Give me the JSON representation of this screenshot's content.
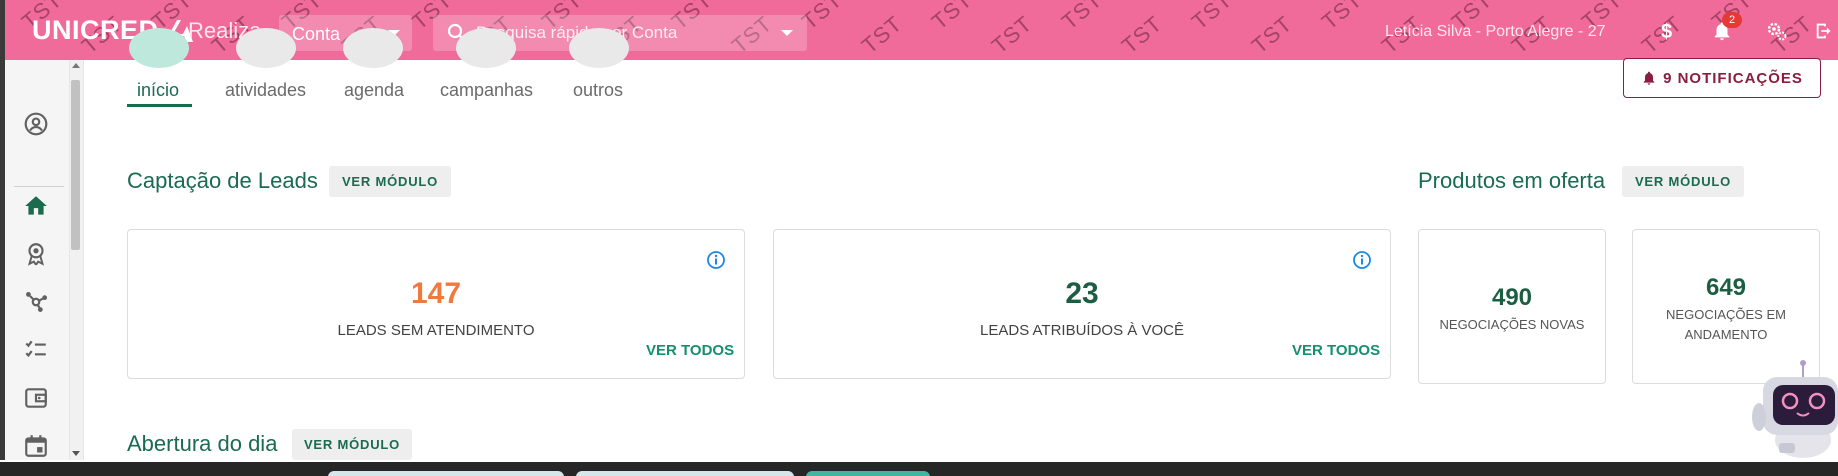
{
  "header": {
    "logo_text": "UNICRED",
    "app_name": "Realiza",
    "context_select_value": "Conta",
    "search_placeholder": "Pesquisa rápida por Conta",
    "user_info": "Letícia Silva   -   Porto Alegre - 27",
    "notifications_badge": "2",
    "watermark_text": "TST",
    "icons": [
      "dollar-icon",
      "bell-icon",
      "settings-icon",
      "logout-icon"
    ],
    "bar_color": "#f06a9a"
  },
  "sidebar": {
    "items": [
      {
        "name": "account-icon",
        "active": false
      },
      {
        "name": "home-icon",
        "active": true
      },
      {
        "name": "award-icon",
        "active": false
      },
      {
        "name": "hub-icon",
        "active": false
      },
      {
        "name": "checklist-icon",
        "active": false
      },
      {
        "name": "wallet-icon",
        "active": false
      },
      {
        "name": "calendar-icon",
        "active": false
      }
    ]
  },
  "tabs": [
    {
      "label": "início",
      "active": true
    },
    {
      "label": "atividades",
      "active": false
    },
    {
      "label": "agenda",
      "active": false
    },
    {
      "label": "campanhas",
      "active": false
    },
    {
      "label": "outros",
      "active": false
    }
  ],
  "notifications_button": "9 NOTIFICAÇÕES",
  "sections": {
    "leads": {
      "title": "Captação de Leads",
      "module_button": "VER MÓDULO",
      "cards": [
        {
          "value": "147",
          "label": "LEADS SEM ATENDIMENTO",
          "link": "VER TODOS",
          "value_color": "#f07a3e"
        },
        {
          "value": "23",
          "label": "LEADS ATRIBUÍDOS À VOCÊ",
          "link": "VER TODOS",
          "value_color": "#1b5e42"
        }
      ]
    },
    "products": {
      "title": "Produtos em oferta",
      "module_button": "VER MÓDULO",
      "cards": [
        {
          "value": "490",
          "label_line1": "NEGOCIAÇÕES NOVAS",
          "label_line2": ""
        },
        {
          "value": "649",
          "label_line1": "NEGOCIAÇÕES EM",
          "label_line2": "ANDAMENTO"
        }
      ]
    },
    "opening": {
      "title": "Abertura do dia",
      "module_button": "VER MÓDULO"
    }
  },
  "colors": {
    "primary_green": "#1b6b4f",
    "accent_teal": "#139070",
    "orange": "#f07a3e",
    "notif_red": "#8a1e3e",
    "info_blue": "#1e88e5"
  }
}
